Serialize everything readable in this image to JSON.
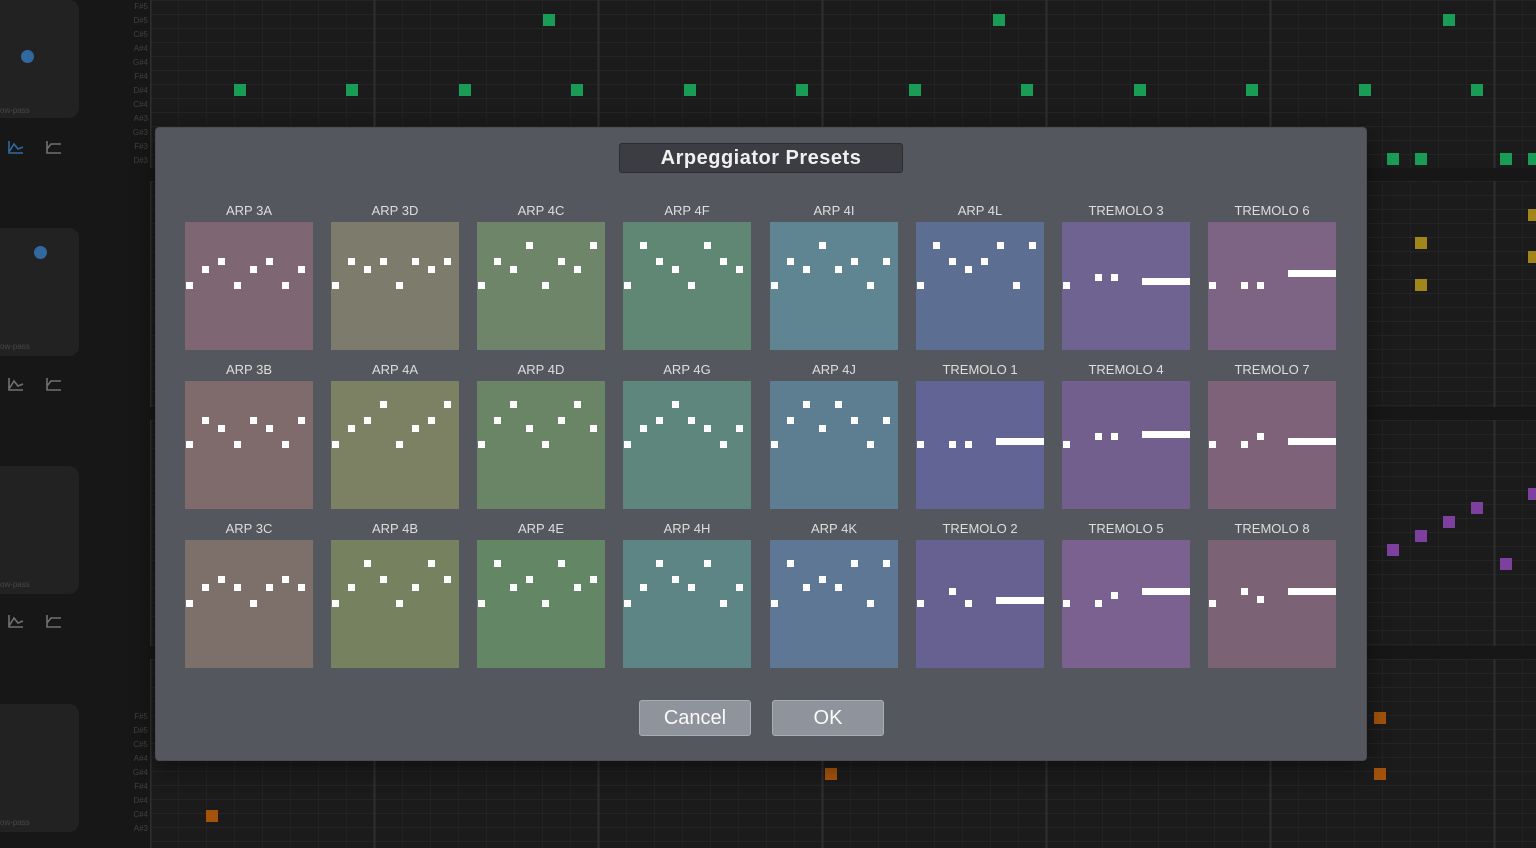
{
  "dialog": {
    "title": "Arpeggiator Presets",
    "cancel_label": "Cancel",
    "ok_label": "OK",
    "presets": [
      {
        "label": "ARP 3A",
        "color": "#7e6672"
      },
      {
        "label": "ARP 3D",
        "color": "#7d7b6b"
      },
      {
        "label": "ARP 4C",
        "color": "#6e8569"
      },
      {
        "label": "ARP 4F",
        "color": "#5f8773"
      },
      {
        "label": "ARP 4I",
        "color": "#5e8591"
      },
      {
        "label": "ARP 4L",
        "color": "#5d6e93"
      },
      {
        "label": "TREMOLO 3",
        "color": "#6e6391"
      },
      {
        "label": "TREMOLO 6",
        "color": "#7d6485"
      },
      {
        "label": "ARP 3B",
        "color": "#7f6a6c"
      },
      {
        "label": "ARP 4A",
        "color": "#7c8164"
      },
      {
        "label": "ARP 4D",
        "color": "#6a8566"
      },
      {
        "label": "ARP 4G",
        "color": "#5e867c"
      },
      {
        "label": "ARP 4J",
        "color": "#5d7e90"
      },
      {
        "label": "TREMOLO 1",
        "color": "#616495"
      },
      {
        "label": "TREMOLO 4",
        "color": "#735f8d"
      },
      {
        "label": "TREMOLO 7",
        "color": "#7e6279"
      },
      {
        "label": "ARP 3C",
        "color": "#7d706a"
      },
      {
        "label": "ARP 4B",
        "color": "#76825f"
      },
      {
        "label": "ARP 4E",
        "color": "#638665"
      },
      {
        "label": "ARP 4H",
        "color": "#5d8586"
      },
      {
        "label": "ARP 4K",
        "color": "#5d7794"
      },
      {
        "label": "TREMOLO 2",
        "color": "#666191"
      },
      {
        "label": "TREMOLO 5",
        "color": "#7a6190"
      },
      {
        "label": "TREMOLO 8",
        "color": "#7b6275"
      }
    ]
  },
  "background": {
    "filter_label": "ow-pass",
    "note_names": [
      "F#5",
      "D#5",
      "C#5",
      "A#4",
      "G#4",
      "F#4",
      "D#4",
      "C#4",
      "A#3",
      "G#3",
      "F#3",
      "D#3"
    ],
    "note_colors": {
      "green": "#1fbf6a",
      "yellow": "#c7a420",
      "purple": "#9a4fc1",
      "orange": "#c9650f"
    }
  }
}
